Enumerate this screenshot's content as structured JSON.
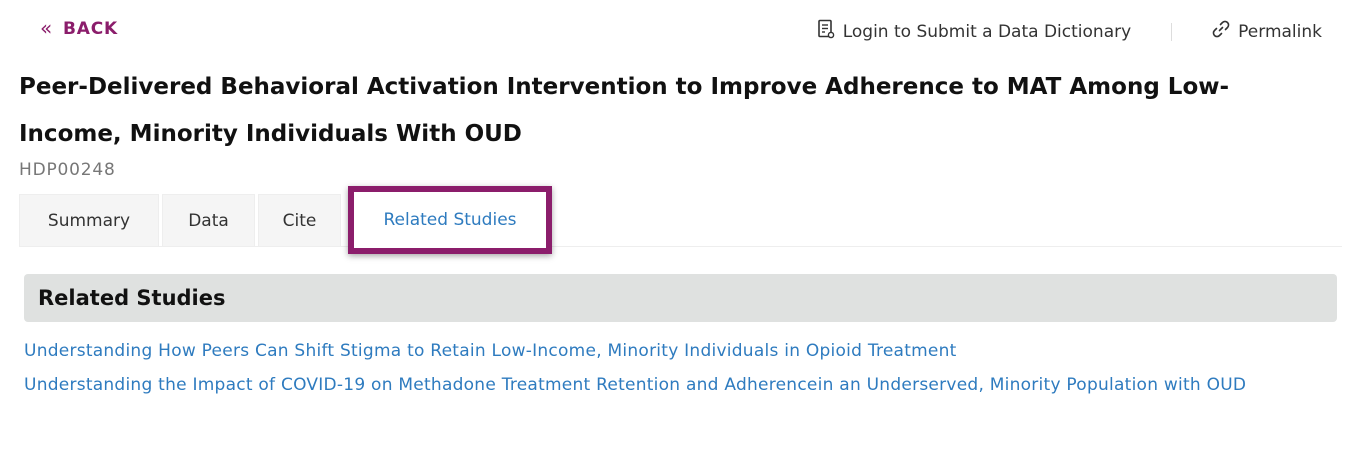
{
  "nav": {
    "back_label": "BACK",
    "login_label": "Login to Submit a Data Dictionary",
    "permalink_label": "Permalink"
  },
  "study": {
    "title": "Peer-Delivered Behavioral Activation Intervention to Improve Adherence to MAT Among Low-Income, Minority Individuals With OUD",
    "id": "HDP00248"
  },
  "tabs": [
    {
      "label": "Summary"
    },
    {
      "label": "Data"
    },
    {
      "label": "Cite"
    },
    {
      "label": "Related Studies"
    }
  ],
  "active_tab": "Related Studies",
  "related": {
    "heading": "Related Studies",
    "items": [
      {
        "label": "Understanding How Peers Can Shift Stigma to Retain Low-Income, Minority Individuals in Opioid Treatment"
      },
      {
        "label": "Understanding the Impact of COVID-19 on Methadone Treatment Retention and Adherencein an Underserved, Minority Population with OUD"
      }
    ]
  },
  "colors": {
    "brand": "#8b1d6b",
    "link": "#2e7bbf",
    "section_bg": "#dfe1e0"
  }
}
